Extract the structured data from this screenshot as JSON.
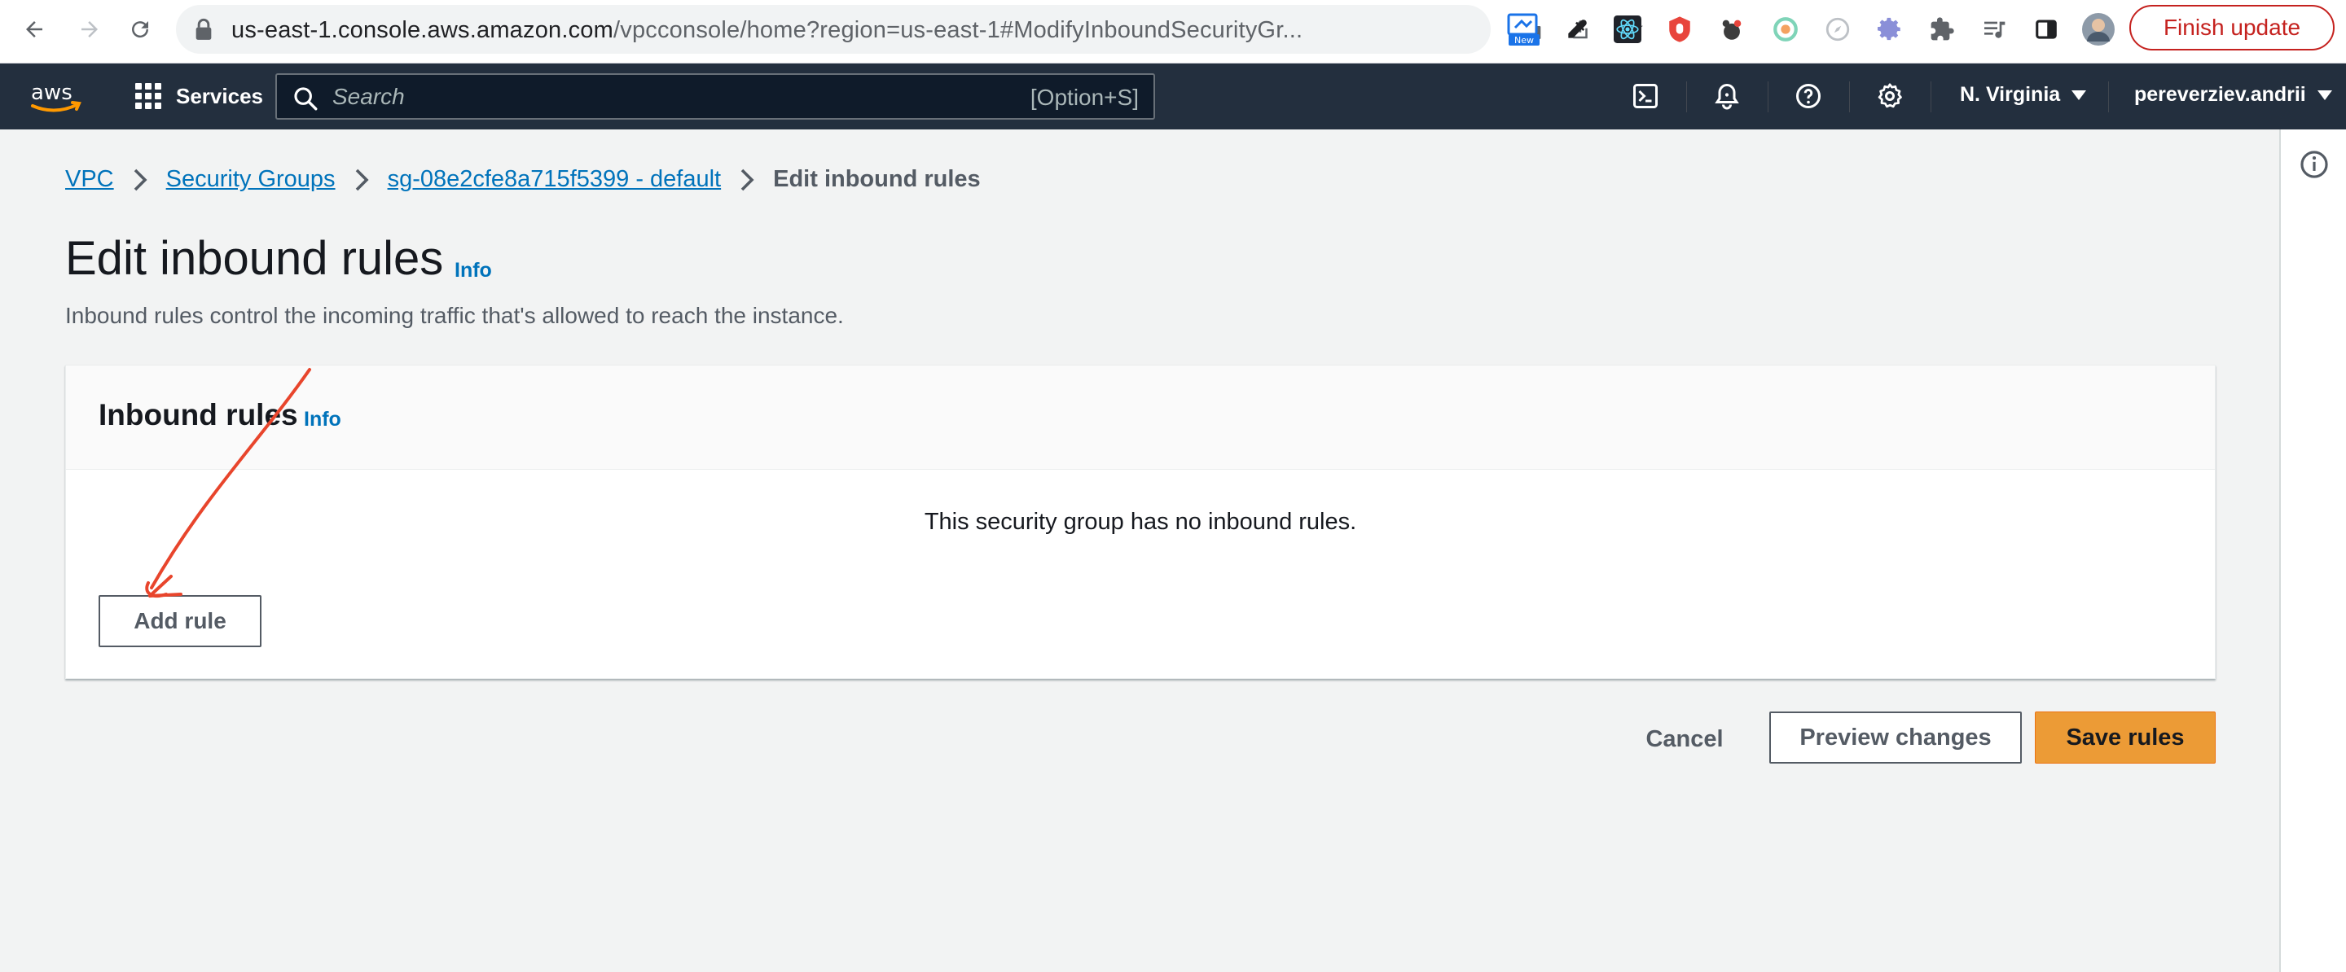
{
  "browser": {
    "url_host": "us-east-1.console.aws.amazon.com",
    "url_path": "/vpcconsole/home?region=us-east-1#ModifyInboundSecurityGr...",
    "new_badge": "New",
    "finish_update": "Finish update"
  },
  "aws_nav": {
    "logo_text": "aws",
    "services_label": "Services",
    "search_placeholder": "Search",
    "search_shortcut": "[Option+S]",
    "region": "N. Virginia",
    "user": "pereverziev.andrii"
  },
  "breadcrumb": {
    "items": [
      "VPC",
      "Security Groups",
      "sg-08e2cfe8a715f5399 - default"
    ],
    "current": "Edit inbound rules"
  },
  "page": {
    "title": "Edit inbound rules",
    "info": "Info",
    "description": "Inbound rules control the incoming traffic that's allowed to reach the instance."
  },
  "panel": {
    "title": "Inbound rules",
    "info": "Info",
    "empty_message": "This security group has no inbound rules.",
    "add_rule_label": "Add rule"
  },
  "actions": {
    "cancel": "Cancel",
    "preview": "Preview changes",
    "save": "Save rules"
  },
  "colors": {
    "aws_nav_bg": "#232f3e",
    "link": "#0073bb",
    "primary_button": "#ec9b36",
    "annotation_arrow": "#e8452c",
    "finish_update": "#c5221f"
  }
}
